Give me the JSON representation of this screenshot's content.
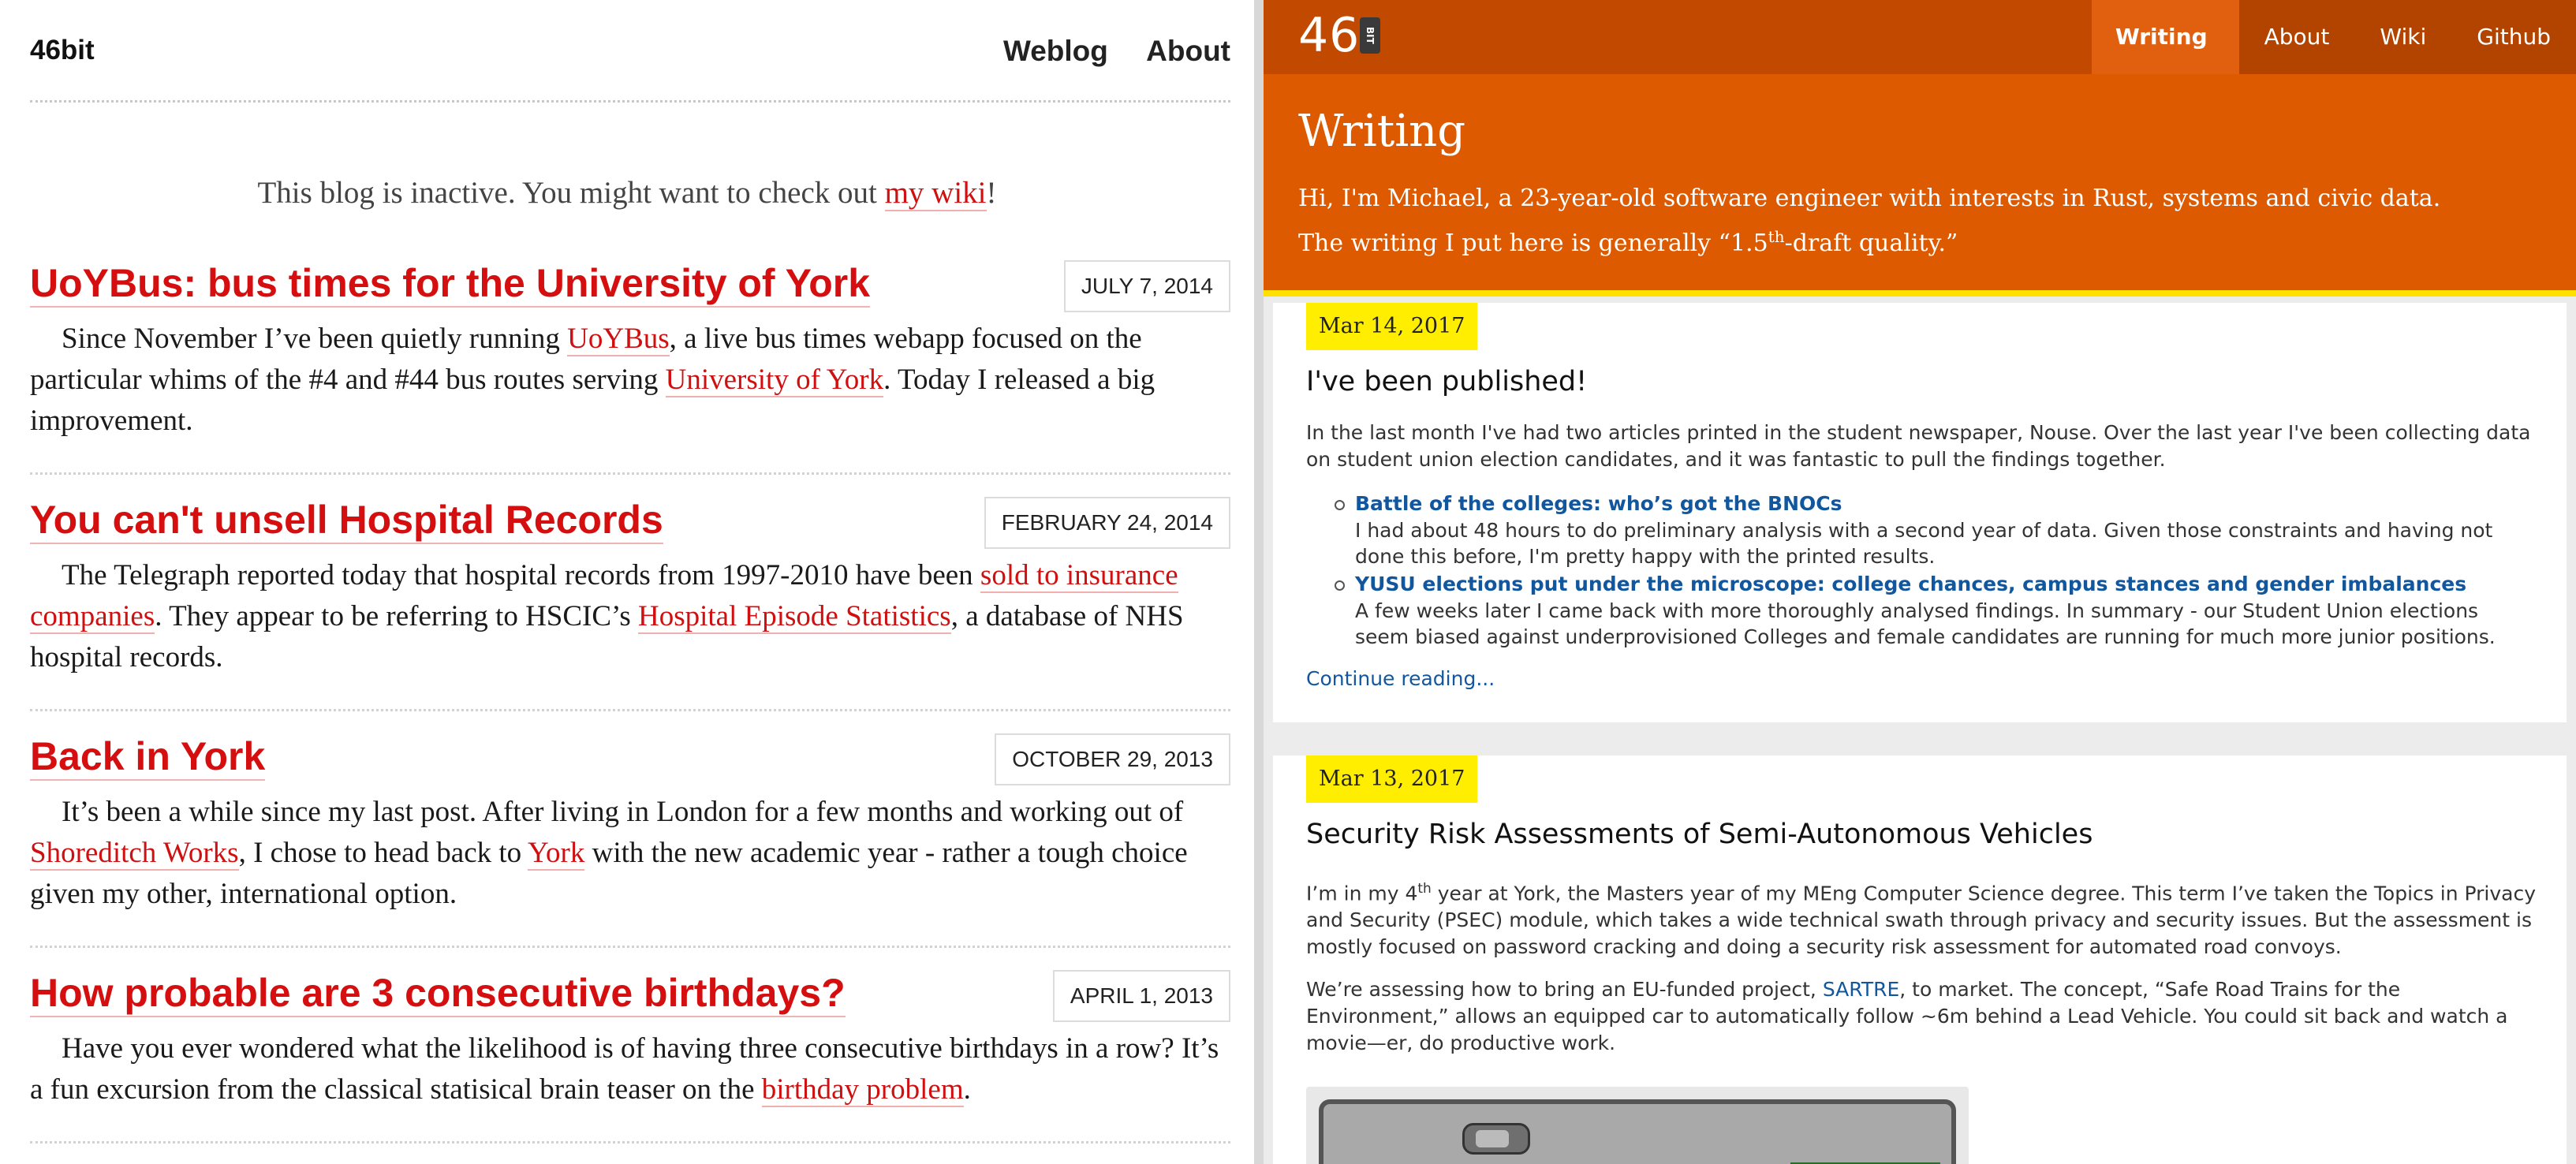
{
  "left": {
    "brand": "46bit",
    "nav": [
      "Weblog",
      "About"
    ],
    "notice": {
      "prefix": "This blog is inactive. You might want to check out ",
      "link": "my wiki",
      "suffix": "!"
    },
    "posts": [
      {
        "title": "UoYBus: bus times for the University of York",
        "date": "JULY 7, 2014",
        "body": [
          {
            "t": "Since November I’ve been quietly running "
          },
          {
            "t": "UoYBus",
            "link": true
          },
          {
            "t": ", a live bus times webapp focused on the particular whims of the #4 and #44 bus routes serving "
          },
          {
            "t": "University of York",
            "link": true
          },
          {
            "t": ". Today I released a big improvement."
          }
        ]
      },
      {
        "title": "You can't unsell Hospital Records",
        "date": "FEBRUARY 24, 2014",
        "body": [
          {
            "t": "The Telegraph reported today that hospital records from 1997-2010 have been "
          },
          {
            "t": "sold to insurance companies",
            "link": true
          },
          {
            "t": ". They appear to be referring to HSCIC’s "
          },
          {
            "t": "Hospital Episode Statistics",
            "link": true
          },
          {
            "t": ", a database of NHS hospital records."
          }
        ]
      },
      {
        "title": "Back in York",
        "date": "OCTOBER 29, 2013",
        "body": [
          {
            "t": "It’s been a while since my last post. After living in London for a few months and working out of "
          },
          {
            "t": "Shoreditch Works",
            "link": true
          },
          {
            "t": ", I chose to head back to "
          },
          {
            "t": "York",
            "link": true
          },
          {
            "t": " with the new academic year - rather a tough choice given my other, international option."
          }
        ]
      },
      {
        "title": "How probable are 3 consecutive birthdays?",
        "date": "APRIL 1, 2013",
        "body": [
          {
            "t": "Have you ever wondered what the likelihood is of having three consecutive birthdays in a row? It’s a fun excursion from the classical statisical brain teaser on the "
          },
          {
            "t": "birthday problem",
            "link": true
          },
          {
            "t": "."
          }
        ]
      }
    ]
  },
  "right": {
    "logo_number": "46",
    "logo_badge": "BIT",
    "nav": [
      {
        "label": "Writing",
        "active": true
      },
      {
        "label": "About",
        "active": false
      },
      {
        "label": "Wiki",
        "active": false
      },
      {
        "label": "Github",
        "active": false
      }
    ],
    "hero": {
      "title": "Writing",
      "line1": "Hi, I'm Michael, a 23-year-old software engineer with interests in Rust, systems and civic data.",
      "line2_pre": "The writing I put here is generally “1.5",
      "line2_sup": "th",
      "line2_post": "-draft quality.”"
    },
    "posts": [
      {
        "date": "Mar 14, 2017",
        "title": "I've been published!",
        "intro": "In the last month I've had two articles printed in the student newspaper, Nouse. Over the last year I've been collecting data on student union election candidates, and it was fantastic to pull the findings together.",
        "items": [
          {
            "title": "Battle of the colleges: who’s got the BNOCs",
            "desc": "I had about 48 hours to do preliminary analysis with a second year of data. Given those constraints and having not done this before, I'm pretty happy with the printed results."
          },
          {
            "title": "YUSU elections put under the microscope: college chances, campus stances and gender imbalances",
            "desc": "A few weeks later I came back with more thoroughly analysed findings. In summary - our Student Union elections seem biased against underprovisioned Colleges and female candidates are running for much more junior positions."
          }
        ],
        "continue": "Continue reading..."
      },
      {
        "date": "Mar 13, 2017",
        "title": "Security Risk Assessments of Semi-Autonomous Vehicles",
        "p1_pre": "I’m in my 4",
        "p1_sup": "th",
        "p1_post": " year at York, the Masters year of my MEng Computer Science degree. This term I’ve taken the Topics in Privacy and Security (PSEC) module, which takes a wide technical swath through privacy and security issues. But the assessment is mostly focused on password cracking and doing a security risk assessment for automated road convoys.",
        "p2_pre": "We’re assessing how to bring an EU-funded project, ",
        "p2_link": "SARTRE",
        "p2_post": ", to market. The concept, “Safe Road Trains for the Environment,” allows an equipped car to automatically follow ~6m behind a Lead Vehicle. You could sit back and watch a movie—er, do productive work."
      }
    ]
  },
  "colors": {
    "left_accent": "#d50f0f",
    "right_header": "#c24a00",
    "right_hero": "#dd5a00",
    "highlight": "#ffee00",
    "right_link": "#12579e"
  }
}
